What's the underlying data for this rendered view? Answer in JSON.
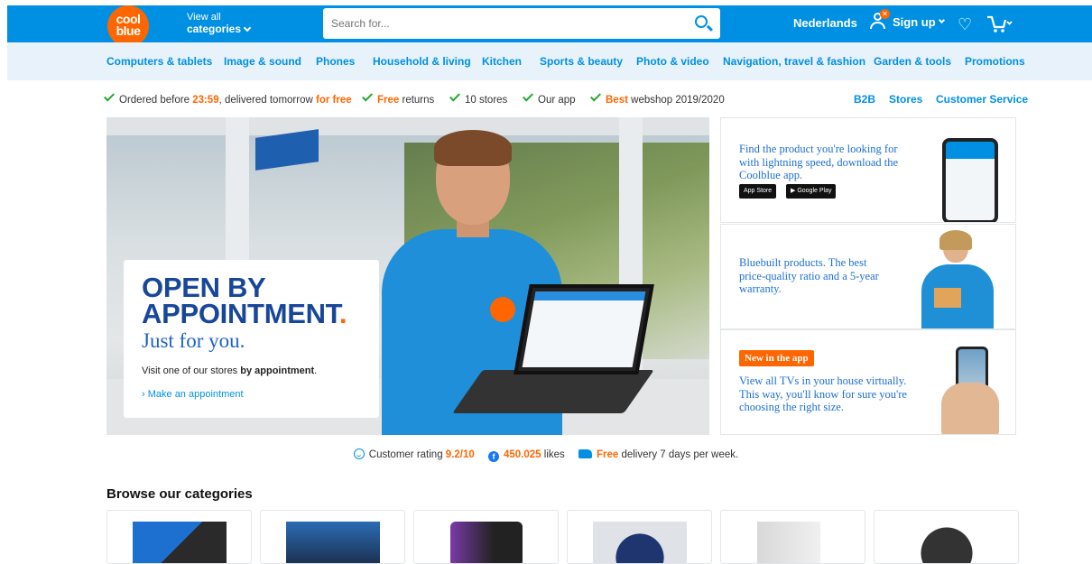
{
  "header": {
    "logo_line1": "cool",
    "logo_line2": "blue",
    "view_all_line1": "View all",
    "view_all_line2": "categories",
    "search_placeholder": "Search for...",
    "language": "Nederlands",
    "signup": "Sign up"
  },
  "nav": {
    "items": [
      "Computers & tablets",
      "Image & sound",
      "Phones",
      "Household & living",
      "Kitchen",
      "Sports & beauty",
      "Photo & video",
      "Navigation, travel & fashion",
      "Garden & tools",
      "Promotions"
    ]
  },
  "usp": {
    "ordered_prefix": "Ordered before ",
    "ordered_time": "23:59",
    "ordered_mid": ", delivered tomorrow ",
    "ordered_free": "for free",
    "returns_free": "Free",
    "returns_text": " returns",
    "stores": "10 stores",
    "app": "Our app",
    "best": "Best",
    "best_text": " webshop 2019/2020",
    "links": [
      "B2B",
      "Stores",
      "Customer Service"
    ]
  },
  "hero": {
    "title_line1": "OPEN BY",
    "title_line2": "APPOINTMENT",
    "title_dot": ".",
    "subtitle": "Just for you.",
    "text_prefix": "Visit one of our stores ",
    "text_bold": "by appointment",
    "text_suffix": ".",
    "link": "Make an appointment"
  },
  "side": {
    "app_text": "Find the product you're looking for with lightning speed, download the Coolblue app.",
    "app_store": "App Store",
    "google_play": "Google Play",
    "bluebuilt_text": "Bluebuilt products. The best price-quality ratio and a 5-year warranty.",
    "new_badge": "New in the app",
    "tv_text": "View all TVs in your house virtually. This way, you'll know for sure you're choosing the right size."
  },
  "ratings": {
    "rating_prefix": "Customer rating ",
    "rating_value": "9.2/10",
    "likes_value": "450.025",
    "likes_suffix": " likes",
    "delivery_free": "Free",
    "delivery_text": " delivery 7 days per week."
  },
  "browse": {
    "title": "Browse our categories"
  },
  "colors": {
    "brand_blue": "#0090e3",
    "brand_orange": "#ff6600",
    "check_green": "#22a82a",
    "nav_bg": "#e8f2fb"
  },
  "icons": [
    "search-icon",
    "chevron-down-icon",
    "person-icon",
    "heart-icon",
    "cart-icon",
    "check-icon",
    "smile-icon",
    "facebook-icon",
    "truck-icon"
  ]
}
